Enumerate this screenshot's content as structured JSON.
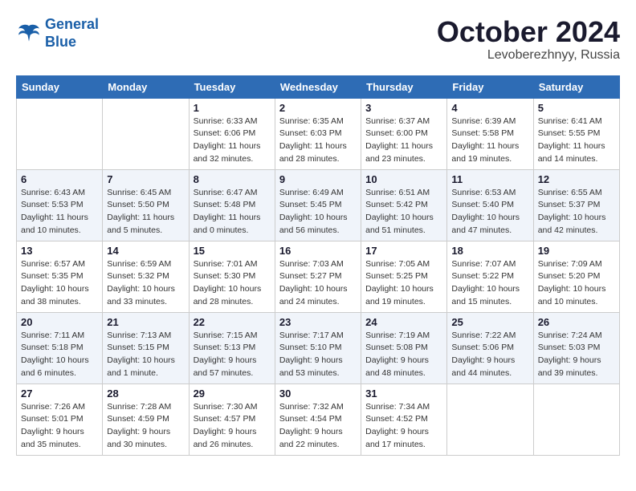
{
  "logo": {
    "line1": "General",
    "line2": "Blue"
  },
  "title": "October 2024",
  "location": "Levoberezhnyy, Russia",
  "weekdays": [
    "Sunday",
    "Monday",
    "Tuesday",
    "Wednesday",
    "Thursday",
    "Friday",
    "Saturday"
  ],
  "weeks": [
    [
      {
        "day": "",
        "sunrise": "",
        "sunset": "",
        "daylight": ""
      },
      {
        "day": "",
        "sunrise": "",
        "sunset": "",
        "daylight": ""
      },
      {
        "day": "1",
        "sunrise": "Sunrise: 6:33 AM",
        "sunset": "Sunset: 6:06 PM",
        "daylight": "Daylight: 11 hours and 32 minutes."
      },
      {
        "day": "2",
        "sunrise": "Sunrise: 6:35 AM",
        "sunset": "Sunset: 6:03 PM",
        "daylight": "Daylight: 11 hours and 28 minutes."
      },
      {
        "day": "3",
        "sunrise": "Sunrise: 6:37 AM",
        "sunset": "Sunset: 6:00 PM",
        "daylight": "Daylight: 11 hours and 23 minutes."
      },
      {
        "day": "4",
        "sunrise": "Sunrise: 6:39 AM",
        "sunset": "Sunset: 5:58 PM",
        "daylight": "Daylight: 11 hours and 19 minutes."
      },
      {
        "day": "5",
        "sunrise": "Sunrise: 6:41 AM",
        "sunset": "Sunset: 5:55 PM",
        "daylight": "Daylight: 11 hours and 14 minutes."
      }
    ],
    [
      {
        "day": "6",
        "sunrise": "Sunrise: 6:43 AM",
        "sunset": "Sunset: 5:53 PM",
        "daylight": "Daylight: 11 hours and 10 minutes."
      },
      {
        "day": "7",
        "sunrise": "Sunrise: 6:45 AM",
        "sunset": "Sunset: 5:50 PM",
        "daylight": "Daylight: 11 hours and 5 minutes."
      },
      {
        "day": "8",
        "sunrise": "Sunrise: 6:47 AM",
        "sunset": "Sunset: 5:48 PM",
        "daylight": "Daylight: 11 hours and 0 minutes."
      },
      {
        "day": "9",
        "sunrise": "Sunrise: 6:49 AM",
        "sunset": "Sunset: 5:45 PM",
        "daylight": "Daylight: 10 hours and 56 minutes."
      },
      {
        "day": "10",
        "sunrise": "Sunrise: 6:51 AM",
        "sunset": "Sunset: 5:42 PM",
        "daylight": "Daylight: 10 hours and 51 minutes."
      },
      {
        "day": "11",
        "sunrise": "Sunrise: 6:53 AM",
        "sunset": "Sunset: 5:40 PM",
        "daylight": "Daylight: 10 hours and 47 minutes."
      },
      {
        "day": "12",
        "sunrise": "Sunrise: 6:55 AM",
        "sunset": "Sunset: 5:37 PM",
        "daylight": "Daylight: 10 hours and 42 minutes."
      }
    ],
    [
      {
        "day": "13",
        "sunrise": "Sunrise: 6:57 AM",
        "sunset": "Sunset: 5:35 PM",
        "daylight": "Daylight: 10 hours and 38 minutes."
      },
      {
        "day": "14",
        "sunrise": "Sunrise: 6:59 AM",
        "sunset": "Sunset: 5:32 PM",
        "daylight": "Daylight: 10 hours and 33 minutes."
      },
      {
        "day": "15",
        "sunrise": "Sunrise: 7:01 AM",
        "sunset": "Sunset: 5:30 PM",
        "daylight": "Daylight: 10 hours and 28 minutes."
      },
      {
        "day": "16",
        "sunrise": "Sunrise: 7:03 AM",
        "sunset": "Sunset: 5:27 PM",
        "daylight": "Daylight: 10 hours and 24 minutes."
      },
      {
        "day": "17",
        "sunrise": "Sunrise: 7:05 AM",
        "sunset": "Sunset: 5:25 PM",
        "daylight": "Daylight: 10 hours and 19 minutes."
      },
      {
        "day": "18",
        "sunrise": "Sunrise: 7:07 AM",
        "sunset": "Sunset: 5:22 PM",
        "daylight": "Daylight: 10 hours and 15 minutes."
      },
      {
        "day": "19",
        "sunrise": "Sunrise: 7:09 AM",
        "sunset": "Sunset: 5:20 PM",
        "daylight": "Daylight: 10 hours and 10 minutes."
      }
    ],
    [
      {
        "day": "20",
        "sunrise": "Sunrise: 7:11 AM",
        "sunset": "Sunset: 5:18 PM",
        "daylight": "Daylight: 10 hours and 6 minutes."
      },
      {
        "day": "21",
        "sunrise": "Sunrise: 7:13 AM",
        "sunset": "Sunset: 5:15 PM",
        "daylight": "Daylight: 10 hours and 1 minute."
      },
      {
        "day": "22",
        "sunrise": "Sunrise: 7:15 AM",
        "sunset": "Sunset: 5:13 PM",
        "daylight": "Daylight: 9 hours and 57 minutes."
      },
      {
        "day": "23",
        "sunrise": "Sunrise: 7:17 AM",
        "sunset": "Sunset: 5:10 PM",
        "daylight": "Daylight: 9 hours and 53 minutes."
      },
      {
        "day": "24",
        "sunrise": "Sunrise: 7:19 AM",
        "sunset": "Sunset: 5:08 PM",
        "daylight": "Daylight: 9 hours and 48 minutes."
      },
      {
        "day": "25",
        "sunrise": "Sunrise: 7:22 AM",
        "sunset": "Sunset: 5:06 PM",
        "daylight": "Daylight: 9 hours and 44 minutes."
      },
      {
        "day": "26",
        "sunrise": "Sunrise: 7:24 AM",
        "sunset": "Sunset: 5:03 PM",
        "daylight": "Daylight: 9 hours and 39 minutes."
      }
    ],
    [
      {
        "day": "27",
        "sunrise": "Sunrise: 7:26 AM",
        "sunset": "Sunset: 5:01 PM",
        "daylight": "Daylight: 9 hours and 35 minutes."
      },
      {
        "day": "28",
        "sunrise": "Sunrise: 7:28 AM",
        "sunset": "Sunset: 4:59 PM",
        "daylight": "Daylight: 9 hours and 30 minutes."
      },
      {
        "day": "29",
        "sunrise": "Sunrise: 7:30 AM",
        "sunset": "Sunset: 4:57 PM",
        "daylight": "Daylight: 9 hours and 26 minutes."
      },
      {
        "day": "30",
        "sunrise": "Sunrise: 7:32 AM",
        "sunset": "Sunset: 4:54 PM",
        "daylight": "Daylight: 9 hours and 22 minutes."
      },
      {
        "day": "31",
        "sunrise": "Sunrise: 7:34 AM",
        "sunset": "Sunset: 4:52 PM",
        "daylight": "Daylight: 9 hours and 17 minutes."
      },
      {
        "day": "",
        "sunrise": "",
        "sunset": "",
        "daylight": ""
      },
      {
        "day": "",
        "sunrise": "",
        "sunset": "",
        "daylight": ""
      }
    ]
  ]
}
